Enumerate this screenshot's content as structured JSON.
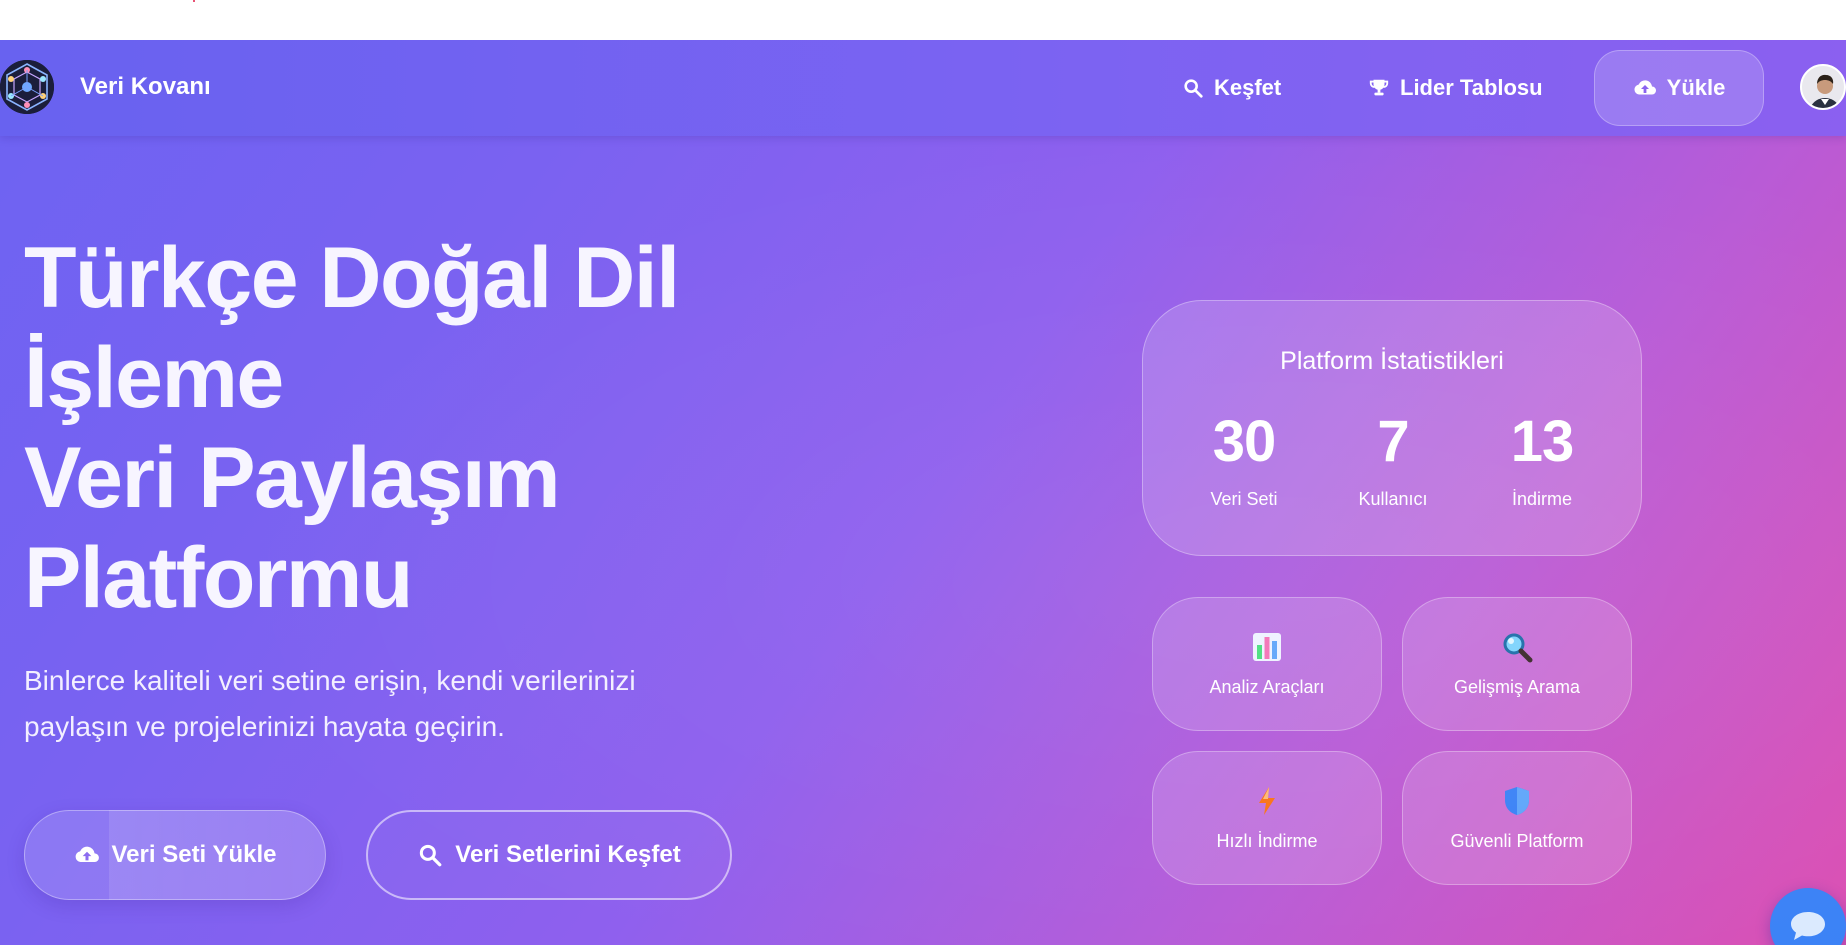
{
  "nav": {
    "brand": "Veri Kovanı",
    "explore": "Keşfet",
    "leaderboard": "Lider Tablosu",
    "upload": "Yükle"
  },
  "hero": {
    "title_lines": [
      "Türkçe Doğal Dil",
      "İşleme",
      "Veri Paylaşım",
      "Platformu"
    ],
    "subtitle_line1": "Binlerce kaliteli veri setine erişin, kendi verilerinizi",
    "subtitle_line2": "paylaşın ve projelerinizi hayata geçirin.",
    "btn_upload": "Veri Seti Yükle",
    "btn_explore": "Veri Setlerini Keşfet"
  },
  "stats": {
    "title": "Platform İstatistikleri",
    "items": [
      {
        "value": "30",
        "label": "Veri Seti"
      },
      {
        "value": "7",
        "label": "Kullanıcı"
      },
      {
        "value": "13",
        "label": "İndirme"
      }
    ]
  },
  "features": [
    {
      "label": "Analiz Araçları",
      "icon": "bar-chart-icon"
    },
    {
      "label": "Gelişmiş Arama",
      "icon": "magnifier-icon"
    },
    {
      "label": "Hızlı İndirme",
      "icon": "lightning-icon"
    },
    {
      "label": "Güvenli Platform",
      "icon": "shield-icon"
    }
  ],
  "colors": {
    "gradient_start": "#6d63f2",
    "gradient_end": "#dc4fb2",
    "chat_button": "#3b82f6"
  }
}
